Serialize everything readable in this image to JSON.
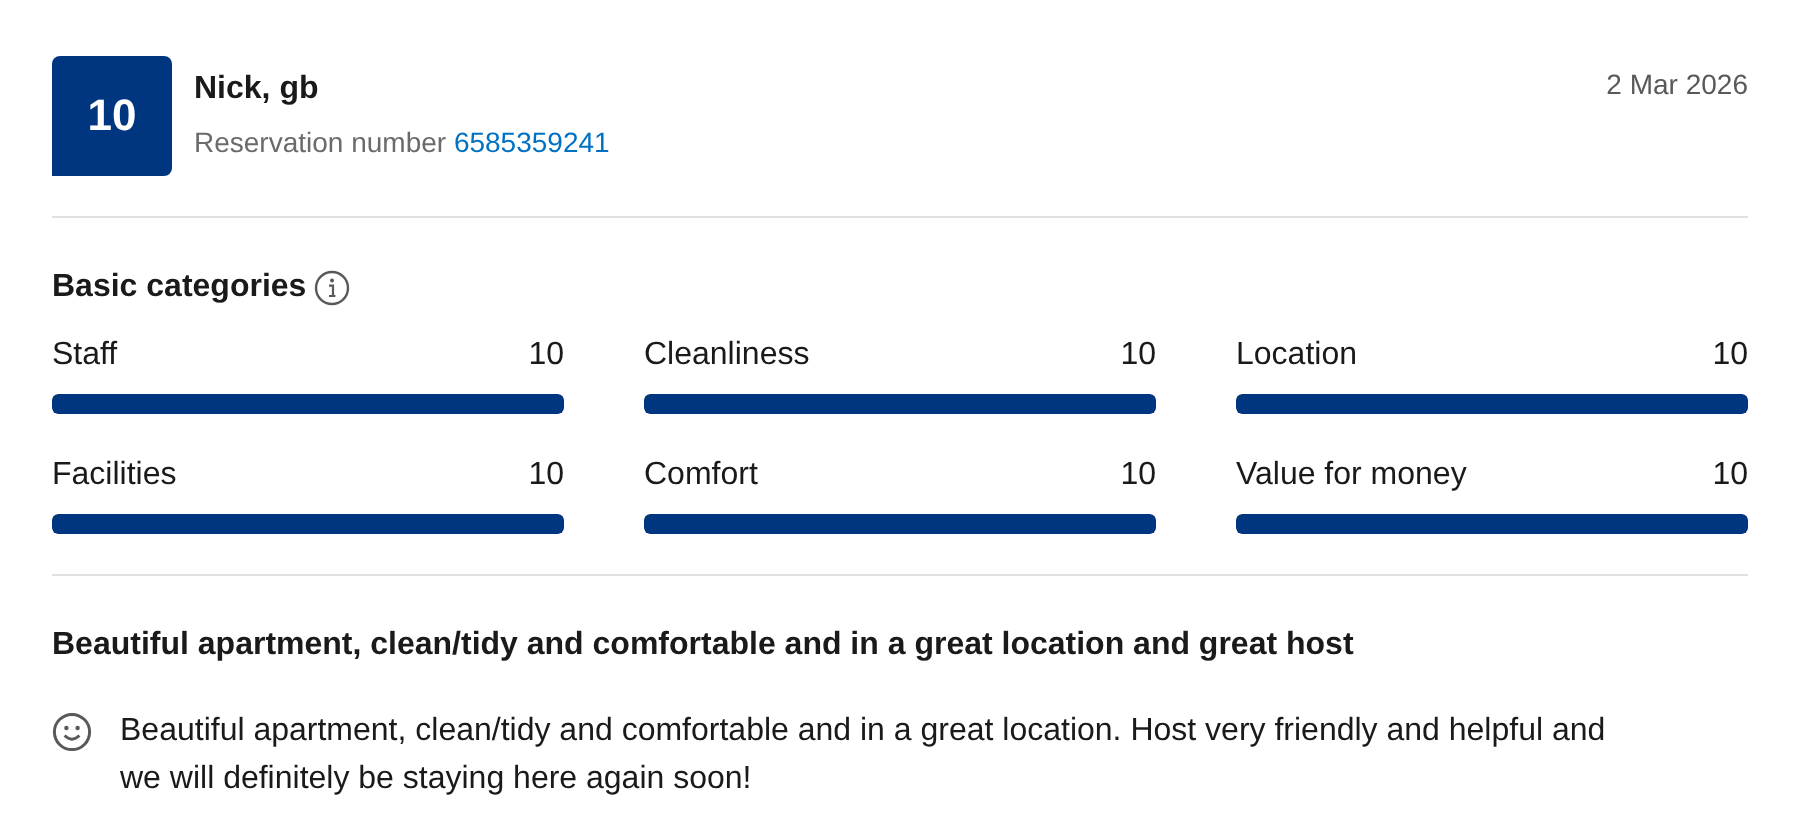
{
  "reviewer": {
    "score": "10",
    "name": "Nick, gb",
    "reservation_label": "Reservation number",
    "reservation_number": "6585359241",
    "date": "2 Mar 2026"
  },
  "categories": {
    "title": "Basic categories",
    "items": [
      {
        "name": "Staff",
        "score": "10",
        "level": 1
      },
      {
        "name": "Cleanliness",
        "score": "10",
        "level": 1
      },
      {
        "name": "Location",
        "score": "10",
        "level": 1
      },
      {
        "name": "Facilities",
        "score": "10",
        "level": 1
      },
      {
        "name": "Comfort",
        "score": "10",
        "level": 1
      },
      {
        "name": "Value for money",
        "score": "10",
        "level": 1
      }
    ]
  },
  "review": {
    "title": "Beautiful apartment, clean/tidy and comfortable and in a great location and great host",
    "positive": "Beautiful apartment, clean/tidy and comfortable and in a great location. Host very friendly and helpful and we will definitely be staying here again soon!"
  }
}
